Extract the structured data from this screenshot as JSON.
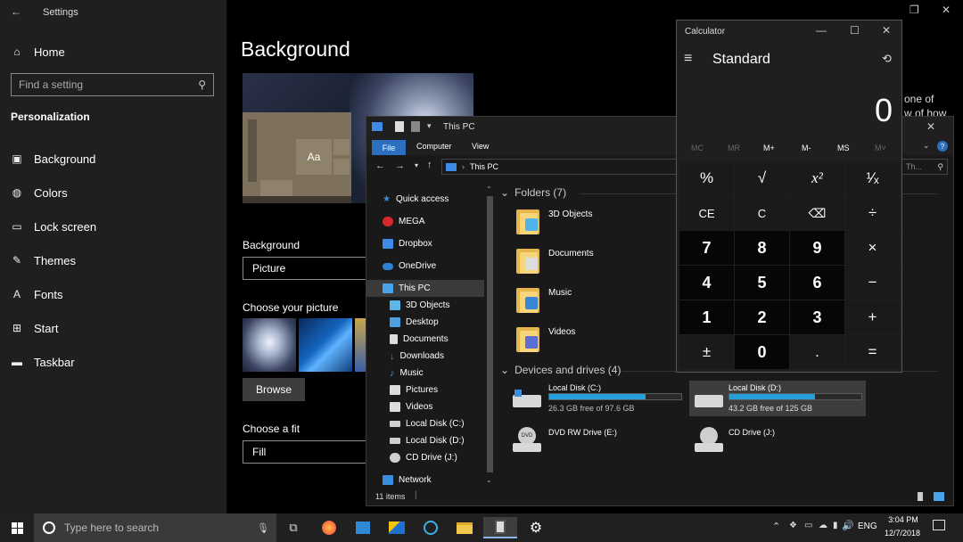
{
  "settings": {
    "title": "Settings",
    "home": "Home",
    "search_placeholder": "Find a setting",
    "section": "Personalization",
    "nav": [
      {
        "label": "Background"
      },
      {
        "label": "Colors"
      },
      {
        "label": "Lock screen"
      },
      {
        "label": "Themes"
      },
      {
        "label": "Fonts"
      },
      {
        "label": "Start"
      },
      {
        "label": "Taskbar"
      }
    ],
    "page_title": "Background",
    "preview_sample": "Aa",
    "background_label": "Background",
    "background_value": "Picture",
    "choose_picture_label": "Choose your picture",
    "browse_label": "Browse",
    "choose_fit_label": "Choose a fit",
    "fit_value": "Fill",
    "side_text_1": "one of",
    "side_text_2": "w of how"
  },
  "explorer": {
    "title": "This PC",
    "ribbon_tabs": [
      "File",
      "Computer",
      "View"
    ],
    "address": "This PC",
    "search_placeholder": "Th...",
    "nav_items": [
      {
        "label": "Quick access",
        "color": "#3b8fd9"
      },
      {
        "label": "MEGA",
        "color": "#d9272e"
      },
      {
        "label": "Dropbox",
        "color": "#3d8be6"
      },
      {
        "label": "OneDrive",
        "color": "#2f7fd3"
      },
      {
        "label": "This PC",
        "color": "#4aa3e8"
      },
      {
        "label": "3D Objects",
        "color": "#5bb5e6"
      },
      {
        "label": "Desktop",
        "color": "#4aa0e0"
      },
      {
        "label": "Documents",
        "color": "#dcdcdc"
      },
      {
        "label": "Downloads",
        "color": "#3a8ee0"
      },
      {
        "label": "Music",
        "color": "#3a8ee0"
      },
      {
        "label": "Pictures",
        "color": "#dcdcdc"
      },
      {
        "label": "Videos",
        "color": "#dcdcdc"
      },
      {
        "label": "Local Disk (C:)",
        "color": "#cfcfcf"
      },
      {
        "label": "Local Disk (D:)",
        "color": "#cfcfcf"
      },
      {
        "label": "CD Drive (J:)",
        "color": "#cfcfcf"
      },
      {
        "label": "Network",
        "color": "#3a8ee0"
      }
    ],
    "folders_header": "Folders (7)",
    "folders": [
      {
        "label": "3D Objects",
        "badge": "#4fb3e8"
      },
      {
        "label": "Documents",
        "badge": "#dcdcdc"
      },
      {
        "label": "Music",
        "badge": "#3a86d6"
      },
      {
        "label": "Videos",
        "badge": "#5b6fd3"
      }
    ],
    "drives_header": "Devices and drives (4)",
    "drives": [
      {
        "label": "Local Disk (C:)",
        "free": "26.3 GB free of 97.6 GB",
        "used_fraction": 0.73
      },
      {
        "label": "Local Disk (D:)",
        "free": "43.2 GB free of 125 GB",
        "used_fraction": 0.65
      },
      {
        "label": "DVD RW Drive (E:)"
      },
      {
        "label": "CD Drive (J:)"
      }
    ],
    "status": "11 items"
  },
  "calculator": {
    "title": "Calculator",
    "mode": "Standard",
    "display": "0",
    "memory": [
      "MC",
      "MR",
      "M+",
      "M-",
      "MS",
      "M˅"
    ],
    "keys": [
      [
        "%",
        "√",
        "x²",
        "¹⁄ₓ"
      ],
      [
        "CE",
        "C",
        "⌫",
        "÷"
      ],
      [
        "7",
        "8",
        "9",
        "×"
      ],
      [
        "4",
        "5",
        "6",
        "−"
      ],
      [
        "1",
        "2",
        "3",
        "+"
      ],
      [
        "±",
        "0",
        ".",
        "="
      ]
    ]
  },
  "taskbar": {
    "search_placeholder": "Type here to search",
    "language": "ENG",
    "time": "3:04 PM",
    "date": "12/7/2018"
  }
}
